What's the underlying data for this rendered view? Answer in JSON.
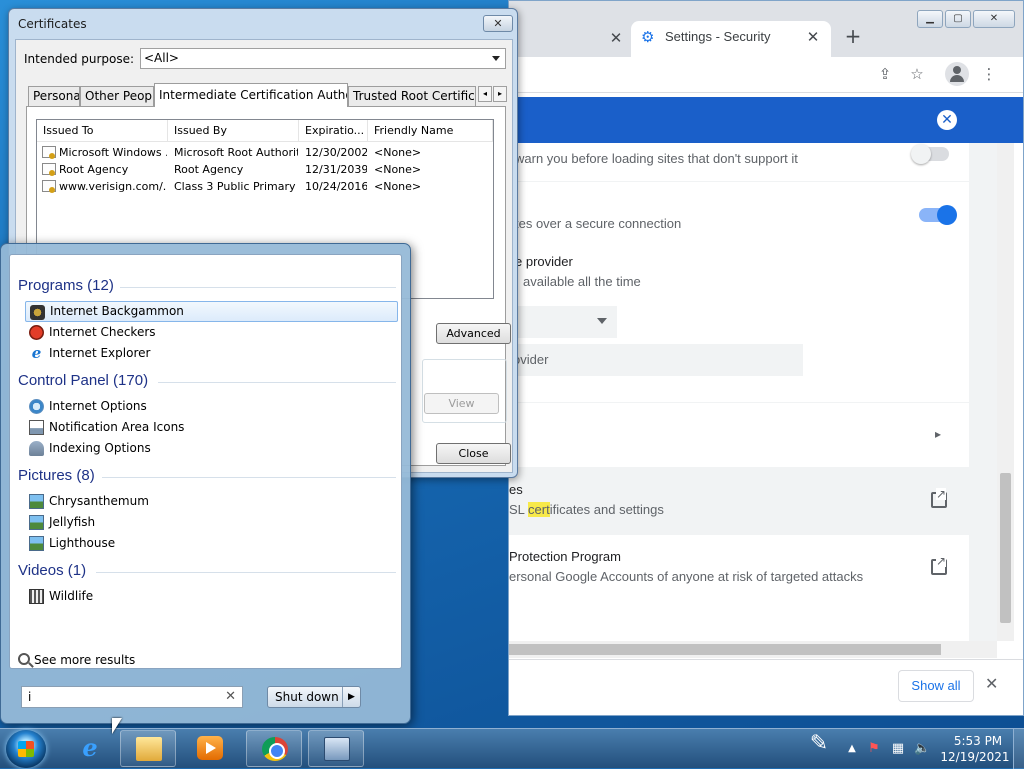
{
  "chrome": {
    "tabs": [
      {
        "title": "",
        "active": false
      },
      {
        "title": "Settings - Security",
        "active": true
      }
    ],
    "settings": {
      "row1_text": "warn you before loading sites that don't support it",
      "row2_text": "tes over a secure connection",
      "row3_title": "e provider",
      "row3_sub": "available all the time",
      "provider_placeholder": "ovider",
      "manage_cert_title": "es",
      "manage_cert_sub_pre": "SL ",
      "manage_cert_sub_hl": "cert",
      "manage_cert_sub_post": "ificates and settings",
      "app_title": "Protection Program",
      "app_sub": "ersonal Google Accounts of anyone at risk of targeted attacks",
      "toggle_warn_on": false,
      "toggle_secure_on": true
    },
    "download_bar": {
      "show_all_label": "Show all"
    }
  },
  "cert_dialog": {
    "title": "Certificates",
    "purpose_label": "Intended purpose:",
    "purpose_value": "<All>",
    "tabs": [
      "Personal",
      "Other People",
      "Intermediate Certification Authorities",
      "Trusted Root Certificatio"
    ],
    "active_tab": 2,
    "columns": [
      "Issued To",
      "Issued By",
      "Expiratio...",
      "Friendly Name"
    ],
    "rows": [
      {
        "issued_to": "Microsoft Windows ...",
        "issued_by": "Microsoft Root Authority",
        "expiration": "12/30/2002",
        "friendly": "<None>"
      },
      {
        "issued_to": "Root Agency",
        "issued_by": "Root Agency",
        "expiration": "12/31/2039",
        "friendly": "<None>"
      },
      {
        "issued_to": "www.verisign.com/...",
        "issued_by": "Class 3 Public Primary ...",
        "expiration": "10/24/2016",
        "friendly": "<None>"
      }
    ],
    "advanced_label": "Advanced",
    "view_label": "View",
    "close_label": "Close"
  },
  "start_menu": {
    "groups": [
      {
        "header": "Programs (12)",
        "items": [
          {
            "label": "Internet Backgammon",
            "icon": "backgammon-icon",
            "selected": true
          },
          {
            "label": "Internet Checkers",
            "icon": "checkers-icon",
            "selected": false
          },
          {
            "label": "Internet Explorer",
            "icon": "internet-explorer-icon",
            "selected": false
          }
        ]
      },
      {
        "header": "Control Panel (170)",
        "items": [
          {
            "label": "Internet Options",
            "icon": "internet-options-icon"
          },
          {
            "label": "Notification Area Icons",
            "icon": "notification-area-icon"
          },
          {
            "label": "Indexing Options",
            "icon": "indexing-options-icon"
          }
        ]
      },
      {
        "header": "Pictures (8)",
        "items": [
          {
            "label": "Chrysanthemum",
            "icon": "picture-icon"
          },
          {
            "label": "Jellyfish",
            "icon": "picture-icon"
          },
          {
            "label": "Lighthouse",
            "icon": "picture-icon"
          }
        ]
      },
      {
        "header": "Videos (1)",
        "items": [
          {
            "label": "Wildlife",
            "icon": "video-icon"
          }
        ]
      }
    ],
    "see_more_label": "See more results",
    "search_value": "i",
    "shutdown_label": "Shut down"
  },
  "taskbar": {
    "clock_time": "5:53 PM",
    "clock_date": "12/19/2021"
  }
}
